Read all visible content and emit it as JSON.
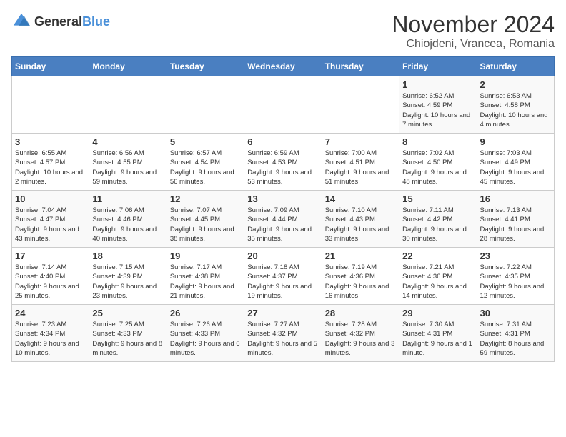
{
  "header": {
    "logo_general": "General",
    "logo_blue": "Blue",
    "main_title": "November 2024",
    "subtitle": "Chiojdeni, Vrancea, Romania"
  },
  "weekdays": [
    "Sunday",
    "Monday",
    "Tuesday",
    "Wednesday",
    "Thursday",
    "Friday",
    "Saturday"
  ],
  "weeks": [
    [
      {
        "day": "",
        "detail": ""
      },
      {
        "day": "",
        "detail": ""
      },
      {
        "day": "",
        "detail": ""
      },
      {
        "day": "",
        "detail": ""
      },
      {
        "day": "",
        "detail": ""
      },
      {
        "day": "1",
        "detail": "Sunrise: 6:52 AM\nSunset: 4:59 PM\nDaylight: 10 hours and 7 minutes."
      },
      {
        "day": "2",
        "detail": "Sunrise: 6:53 AM\nSunset: 4:58 PM\nDaylight: 10 hours and 4 minutes."
      }
    ],
    [
      {
        "day": "3",
        "detail": "Sunrise: 6:55 AM\nSunset: 4:57 PM\nDaylight: 10 hours and 2 minutes."
      },
      {
        "day": "4",
        "detail": "Sunrise: 6:56 AM\nSunset: 4:55 PM\nDaylight: 9 hours and 59 minutes."
      },
      {
        "day": "5",
        "detail": "Sunrise: 6:57 AM\nSunset: 4:54 PM\nDaylight: 9 hours and 56 minutes."
      },
      {
        "day": "6",
        "detail": "Sunrise: 6:59 AM\nSunset: 4:53 PM\nDaylight: 9 hours and 53 minutes."
      },
      {
        "day": "7",
        "detail": "Sunrise: 7:00 AM\nSunset: 4:51 PM\nDaylight: 9 hours and 51 minutes."
      },
      {
        "day": "8",
        "detail": "Sunrise: 7:02 AM\nSunset: 4:50 PM\nDaylight: 9 hours and 48 minutes."
      },
      {
        "day": "9",
        "detail": "Sunrise: 7:03 AM\nSunset: 4:49 PM\nDaylight: 9 hours and 45 minutes."
      }
    ],
    [
      {
        "day": "10",
        "detail": "Sunrise: 7:04 AM\nSunset: 4:47 PM\nDaylight: 9 hours and 43 minutes."
      },
      {
        "day": "11",
        "detail": "Sunrise: 7:06 AM\nSunset: 4:46 PM\nDaylight: 9 hours and 40 minutes."
      },
      {
        "day": "12",
        "detail": "Sunrise: 7:07 AM\nSunset: 4:45 PM\nDaylight: 9 hours and 38 minutes."
      },
      {
        "day": "13",
        "detail": "Sunrise: 7:09 AM\nSunset: 4:44 PM\nDaylight: 9 hours and 35 minutes."
      },
      {
        "day": "14",
        "detail": "Sunrise: 7:10 AM\nSunset: 4:43 PM\nDaylight: 9 hours and 33 minutes."
      },
      {
        "day": "15",
        "detail": "Sunrise: 7:11 AM\nSunset: 4:42 PM\nDaylight: 9 hours and 30 minutes."
      },
      {
        "day": "16",
        "detail": "Sunrise: 7:13 AM\nSunset: 4:41 PM\nDaylight: 9 hours and 28 minutes."
      }
    ],
    [
      {
        "day": "17",
        "detail": "Sunrise: 7:14 AM\nSunset: 4:40 PM\nDaylight: 9 hours and 25 minutes."
      },
      {
        "day": "18",
        "detail": "Sunrise: 7:15 AM\nSunset: 4:39 PM\nDaylight: 9 hours and 23 minutes."
      },
      {
        "day": "19",
        "detail": "Sunrise: 7:17 AM\nSunset: 4:38 PM\nDaylight: 9 hours and 21 minutes."
      },
      {
        "day": "20",
        "detail": "Sunrise: 7:18 AM\nSunset: 4:37 PM\nDaylight: 9 hours and 19 minutes."
      },
      {
        "day": "21",
        "detail": "Sunrise: 7:19 AM\nSunset: 4:36 PM\nDaylight: 9 hours and 16 minutes."
      },
      {
        "day": "22",
        "detail": "Sunrise: 7:21 AM\nSunset: 4:36 PM\nDaylight: 9 hours and 14 minutes."
      },
      {
        "day": "23",
        "detail": "Sunrise: 7:22 AM\nSunset: 4:35 PM\nDaylight: 9 hours and 12 minutes."
      }
    ],
    [
      {
        "day": "24",
        "detail": "Sunrise: 7:23 AM\nSunset: 4:34 PM\nDaylight: 9 hours and 10 minutes."
      },
      {
        "day": "25",
        "detail": "Sunrise: 7:25 AM\nSunset: 4:33 PM\nDaylight: 9 hours and 8 minutes."
      },
      {
        "day": "26",
        "detail": "Sunrise: 7:26 AM\nSunset: 4:33 PM\nDaylight: 9 hours and 6 minutes."
      },
      {
        "day": "27",
        "detail": "Sunrise: 7:27 AM\nSunset: 4:32 PM\nDaylight: 9 hours and 5 minutes."
      },
      {
        "day": "28",
        "detail": "Sunrise: 7:28 AM\nSunset: 4:32 PM\nDaylight: 9 hours and 3 minutes."
      },
      {
        "day": "29",
        "detail": "Sunrise: 7:30 AM\nSunset: 4:31 PM\nDaylight: 9 hours and 1 minute."
      },
      {
        "day": "30",
        "detail": "Sunrise: 7:31 AM\nSunset: 4:31 PM\nDaylight: 8 hours and 59 minutes."
      }
    ]
  ]
}
